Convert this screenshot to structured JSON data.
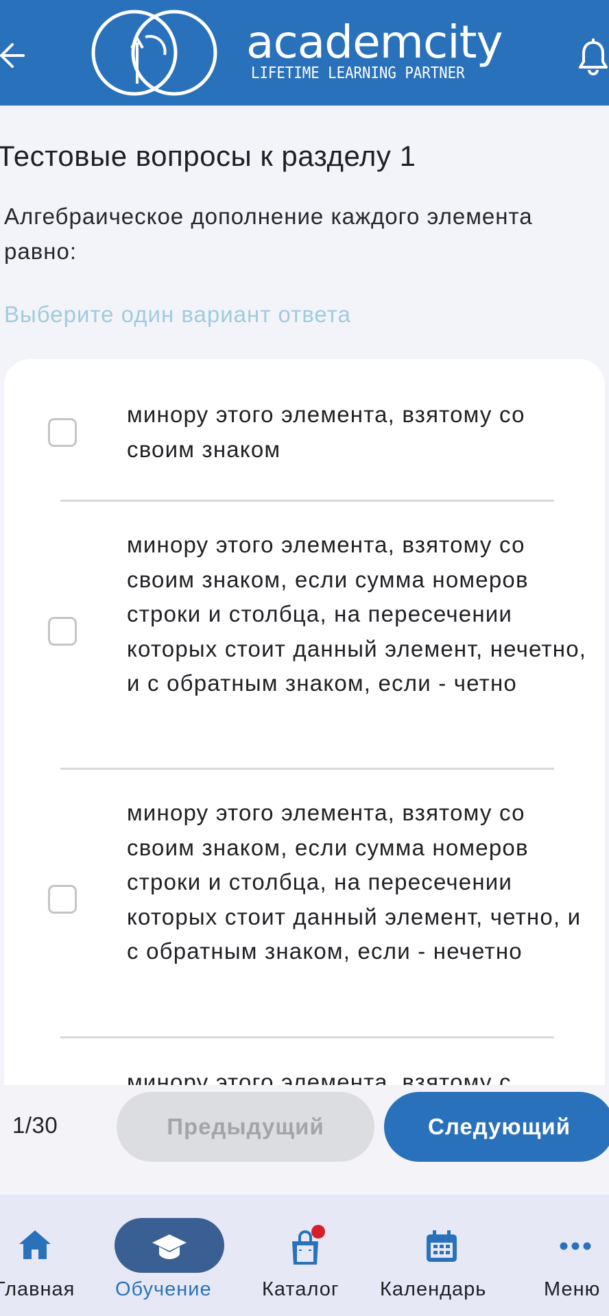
{
  "header": {
    "logo_text": "academcity",
    "logo_tagline": "LIFETIME LEARNING PARTNER",
    "back_icon": "arrow-left-icon",
    "bell_icon": "bell-icon"
  },
  "content": {
    "title": "Тестовые вопросы к разделу 1",
    "question": "Алгебраическое дополнение каждого элемента равно:",
    "hint": "Выберите один вариант ответа",
    "options": [
      {
        "text": "минору этого элемента, взятому со своим знаком",
        "checked": false
      },
      {
        "text": "минору этого элемента, взятому со своим знаком, если сумма номеров строки и столбца, на пересечении которых стоит данный элемент, нечетно, и с обратным знаком, если - четно",
        "checked": false
      },
      {
        "text": "минору этого элемента, взятому со своим знаком, если сумма номеров строки и столбца, на пересечении которых стоит данный элемент, четно, и с обратным знаком, если - нечетно",
        "checked": false
      },
      {
        "text": "минору этого элемента, взятому с",
        "checked": false
      }
    ]
  },
  "pager": {
    "count": "1/30",
    "prev_label": "Предыдущий",
    "next_label": "Следующий"
  },
  "tabs": [
    {
      "label": "Главная",
      "icon": "home-icon",
      "active": false
    },
    {
      "label": "Обучение",
      "icon": "graduation-cap-icon",
      "active": true
    },
    {
      "label": "Каталог",
      "icon": "shopping-bag-icon",
      "active": false,
      "badge": true
    },
    {
      "label": "Календарь",
      "icon": "calendar-icon",
      "active": false
    },
    {
      "label": "Меню",
      "icon": "more-dots-icon",
      "active": false
    }
  ],
  "colors": {
    "brand": "#2a71bb",
    "active_tab": "#3a5f93",
    "hint": "#9fcbe0",
    "badge": "#d61f2c"
  }
}
